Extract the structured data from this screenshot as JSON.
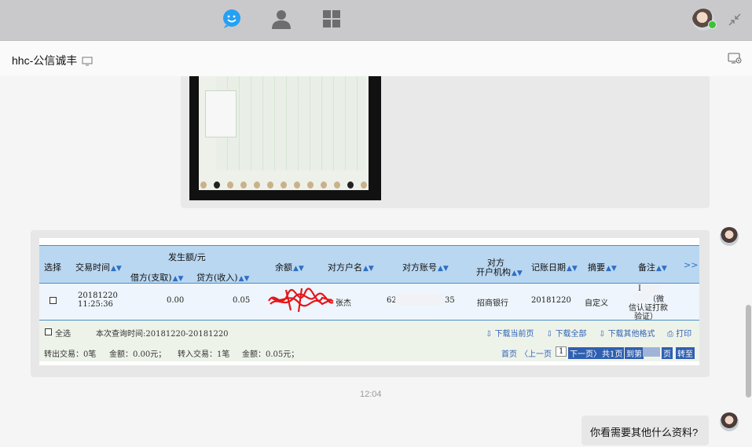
{
  "nav": {
    "chat_icon": "chat-bubble-icon",
    "contacts_icon": "person-icon",
    "apps_icon": "grid-icon"
  },
  "chat": {
    "title": "hhc-公信诚丰"
  },
  "bank_statement": {
    "header": {
      "select": "选择",
      "time": "交易时间",
      "amount_group": "发生额/元",
      "debit": "借方(支取)",
      "credit": "贷方(收入)",
      "balance": "余额",
      "counterparty_name": "对方户名",
      "counterparty_account": "对方账号",
      "counterparty_bank_1": "对方",
      "counterparty_bank_2": "开户机构",
      "posting_date": "记账日期",
      "summary": "摘要",
      "remark": "备注",
      "more": ">>"
    },
    "row": {
      "date": "20181220",
      "time": "11:25:36",
      "debit": "0.00",
      "credit": "0.05",
      "counterparty_name": "张杰",
      "account_prefix": "62",
      "account_suffix": "35",
      "bank": "招商银行",
      "posting_date": "20181220",
      "summary": "自定义",
      "remark_1": "I",
      "remark_2": "（微",
      "remark_3": "信认证打款",
      "remark_4": "验证）"
    },
    "footer": {
      "select_all": "全选",
      "query_time": "本次查询时间:20181220-20181220",
      "download_current": "下载当前页",
      "download_all": "下载全部",
      "download_other": "下载其他格式",
      "print": "打印",
      "out_count": "转出交易：0笔",
      "out_amount": "金额：0.00元；",
      "in_count": "转入交易：1笔",
      "in_amount": "金额：0.05元；",
      "first_page": "首页",
      "prev_page": "〈上一页",
      "current_page": "1",
      "next_page": "下一页〉",
      "total_pages": "共1页",
      "goto": "到第",
      "page_unit": "页",
      "go": "转至"
    }
  },
  "time_separator": "12:04",
  "message": "你看需要其他什么资料?",
  "colors": {
    "header_bg": "#b9d7f1",
    "border_blue": "#4c8fc8",
    "link_blue": "#2f62b5",
    "online_green": "#3dc13c"
  }
}
